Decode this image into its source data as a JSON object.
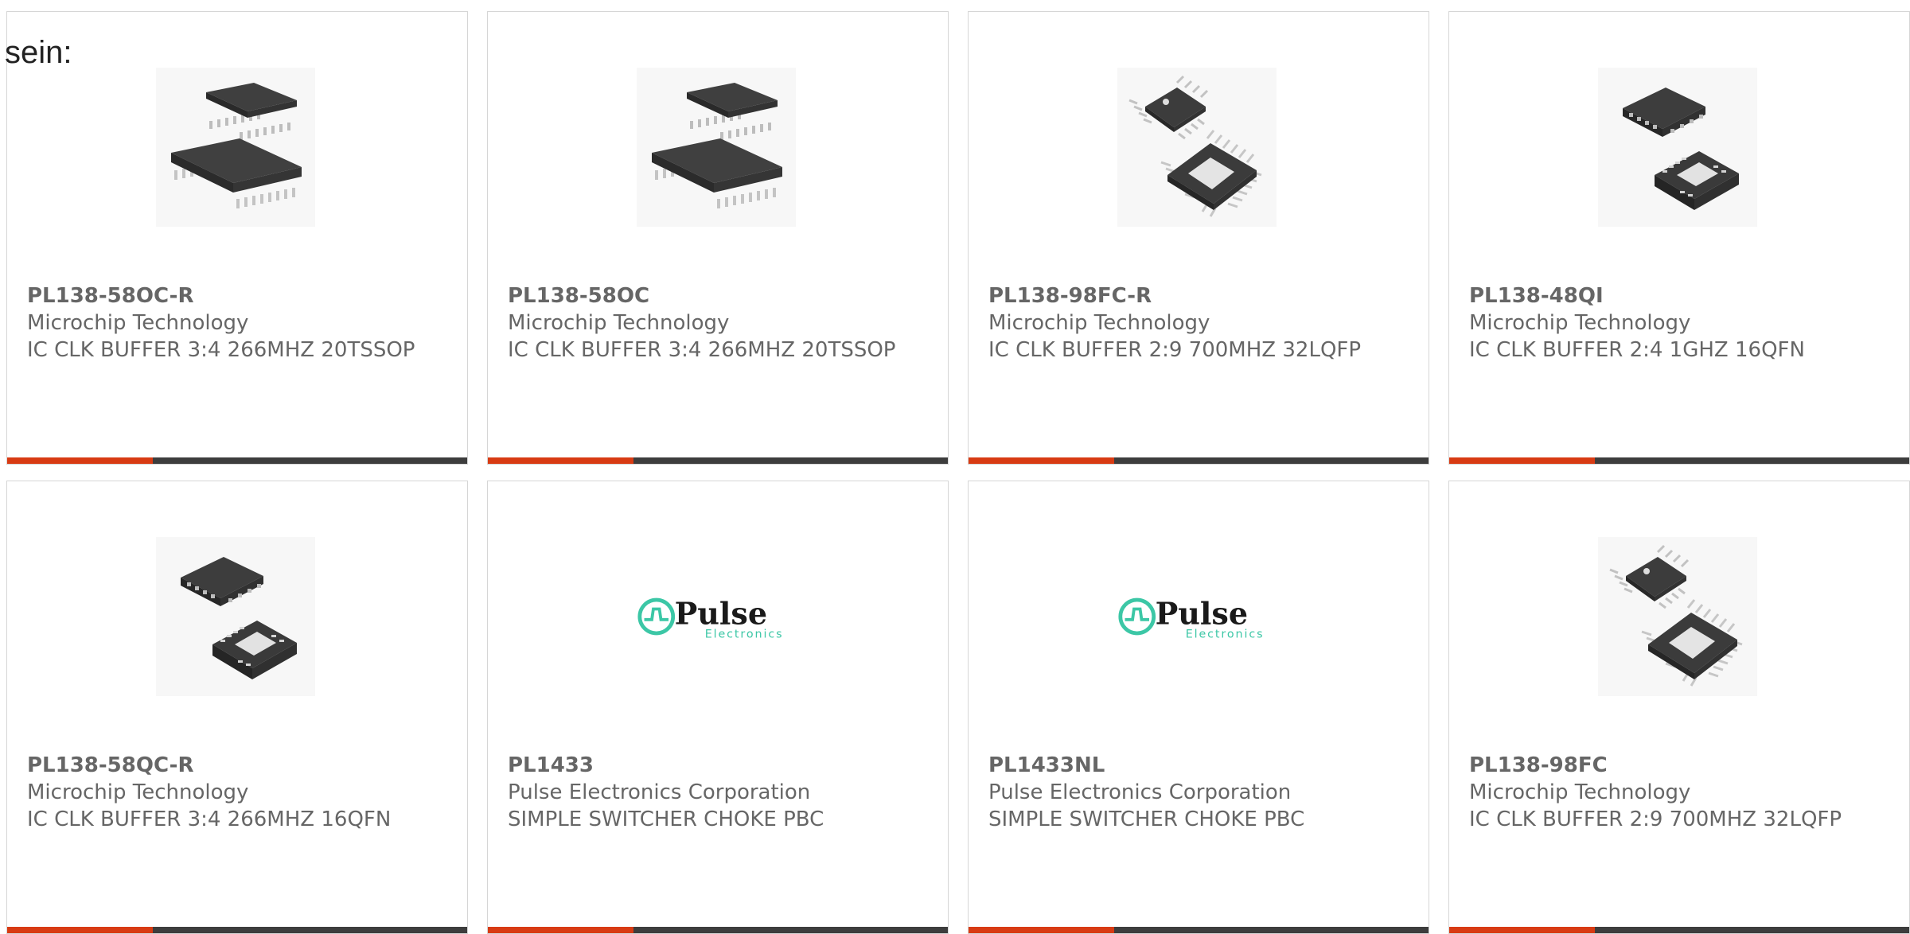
{
  "intro_text": "sein:",
  "colors": {
    "accent_bar": "#d83b13",
    "dark_bar": "#3d3d3d",
    "text": "#666666",
    "pulse_logo": "#3cc7a6"
  },
  "products": [
    {
      "part_number": "PL138-58OC-R",
      "manufacturer": "Microchip Technology",
      "description": "IC CLK BUFFER 3:4 266MHZ 20TSSOP",
      "image_icon": "tssop-chip-icon"
    },
    {
      "part_number": "PL138-58OC",
      "manufacturer": "Microchip Technology",
      "description": "IC CLK BUFFER 3:4 266MHZ 20TSSOP",
      "image_icon": "tssop-chip-icon"
    },
    {
      "part_number": "PL138-98FC-R",
      "manufacturer": "Microchip Technology",
      "description": "IC CLK BUFFER 2:9 700MHZ 32LQFP",
      "image_icon": "lqfp-chip-icon"
    },
    {
      "part_number": "PL138-48QI",
      "manufacturer": "Microchip Technology",
      "description": "IC CLK BUFFER 2:4 1GHZ 16QFN",
      "image_icon": "qfn-chip-icon"
    },
    {
      "part_number": "PL138-58QC-R",
      "manufacturer": "Microchip Technology",
      "description": "IC CLK BUFFER 3:4 266MHZ 16QFN",
      "image_icon": "qfn-chip-icon"
    },
    {
      "part_number": "PL1433",
      "manufacturer": "Pulse Electronics Corporation",
      "description": "SIMPLE SWITCHER CHOKE PBC",
      "image_icon": "pulse-electronics-logo",
      "logo_text": "Pulse",
      "logo_subtext": "Electronics"
    },
    {
      "part_number": "PL1433NL",
      "manufacturer": "Pulse Electronics Corporation",
      "description": "SIMPLE SWITCHER CHOKE PBC",
      "image_icon": "pulse-electronics-logo",
      "logo_text": "Pulse",
      "logo_subtext": "Electronics"
    },
    {
      "part_number": "PL138-98FC",
      "manufacturer": "Microchip Technology",
      "description": "IC CLK BUFFER 2:9 700MHZ 32LQFP",
      "image_icon": "lqfp-chip-icon"
    }
  ]
}
